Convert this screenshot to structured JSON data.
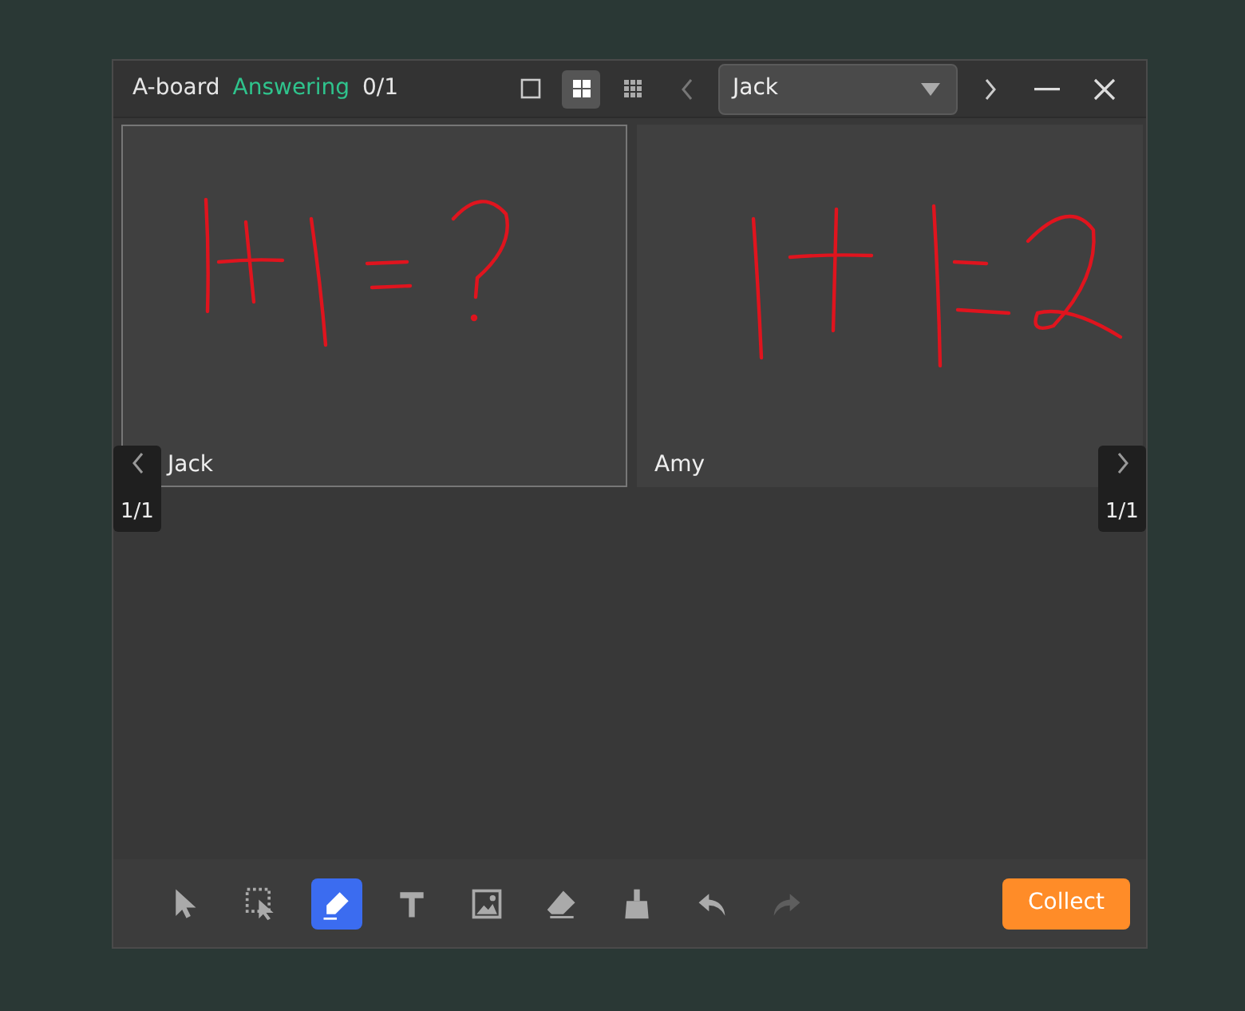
{
  "window": {
    "title": "A-board",
    "status": "Answering",
    "count": "0/1"
  },
  "view_modes": [
    {
      "kind": "single",
      "selected": false
    },
    {
      "kind": "grid4",
      "selected": true
    },
    {
      "kind": "grid9",
      "selected": false
    }
  ],
  "student_select": {
    "value": "Jack"
  },
  "boards": [
    {
      "name": "Jack",
      "selected": true
    },
    {
      "name": "Amy",
      "selected": false
    }
  ],
  "pagers": [
    {
      "text": "1/1"
    },
    {
      "text": "1/1"
    }
  ],
  "tools": [
    {
      "kind": "pointer",
      "selected": false,
      "disabled": false
    },
    {
      "kind": "select",
      "selected": false,
      "disabled": false
    },
    {
      "kind": "pen",
      "selected": true,
      "disabled": false
    },
    {
      "kind": "text",
      "selected": false,
      "disabled": false
    },
    {
      "kind": "image",
      "selected": false,
      "disabled": false
    },
    {
      "kind": "eraser",
      "selected": false,
      "disabled": false
    },
    {
      "kind": "clear",
      "selected": false,
      "disabled": false
    },
    {
      "kind": "undo",
      "selected": false,
      "disabled": false
    },
    {
      "kind": "redo",
      "selected": false,
      "disabled": true
    }
  ],
  "collect_button": "Collect"
}
